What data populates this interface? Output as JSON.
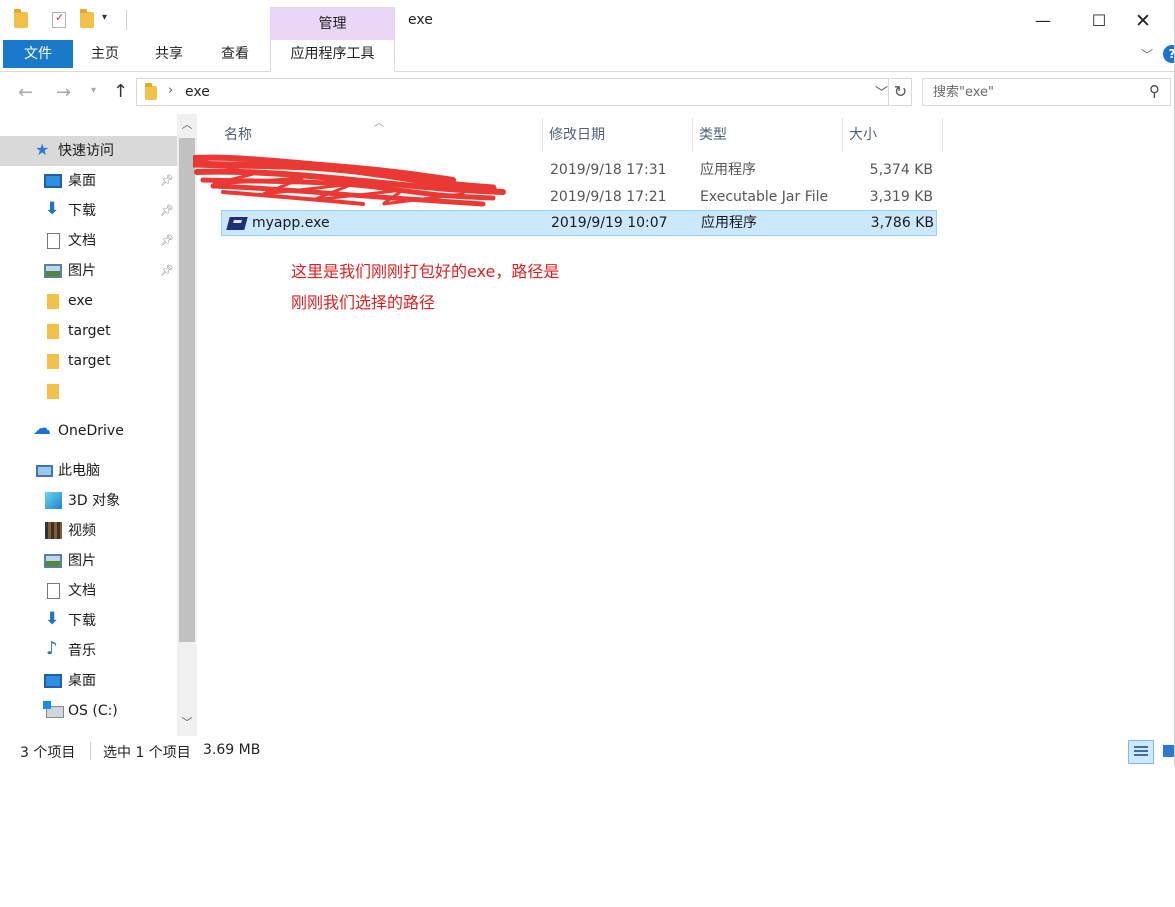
{
  "window": {
    "title": "exe",
    "contextual_tab_group": "管理",
    "controls": {
      "minimize": "—",
      "maximize": "☐",
      "close": "✕"
    }
  },
  "ribbon": {
    "tabs": [
      "文件",
      "主页",
      "共享",
      "查看",
      "应用程序工具"
    ],
    "help_label": "?"
  },
  "address_bar": {
    "path_segment": "exe",
    "search_placeholder": "搜索\"exe\""
  },
  "sidebar": {
    "quick_access": {
      "label": "快速访问"
    },
    "pinned": [
      {
        "label": "桌面",
        "icon": "desktop-icon"
      },
      {
        "label": "下载",
        "icon": "download-icon"
      },
      {
        "label": "文档",
        "icon": "document-icon"
      },
      {
        "label": "图片",
        "icon": "picture-icon"
      }
    ],
    "folders": [
      "exe",
      "target",
      "target",
      ""
    ],
    "onedrive": "OneDrive",
    "this_pc": "此电脑",
    "pc_items": [
      {
        "label": "3D 对象",
        "icon": "cube-3d-icon"
      },
      {
        "label": "视频",
        "icon": "video-icon"
      },
      {
        "label": "图片",
        "icon": "picture-icon"
      },
      {
        "label": "文档",
        "icon": "document-icon"
      },
      {
        "label": "下载",
        "icon": "download-icon"
      },
      {
        "label": "音乐",
        "icon": "music-icon"
      },
      {
        "label": "桌面",
        "icon": "desktop-icon"
      },
      {
        "label": "OS (C:)",
        "icon": "drive-icon"
      }
    ]
  },
  "file_list": {
    "columns": [
      "名称",
      "修改日期",
      "类型",
      "大小"
    ],
    "rows": [
      {
        "name": "",
        "date": "2019/9/18 17:31",
        "type": "应用程序",
        "size": "5,374 KB",
        "selected": false
      },
      {
        "name": "",
        "date": "2019/9/18 17:21",
        "type": "Executable Jar File",
        "size": "3,319 KB",
        "selected": false
      },
      {
        "name": "myapp.exe",
        "date": "2019/9/19 10:07",
        "type": "应用程序",
        "size": "3,786 KB",
        "selected": true
      }
    ]
  },
  "annotation": {
    "line1": "这里是我们刚刚打包好的exe，路径是",
    "line2": "刚刚我们选择的路径",
    "color": "#e02020"
  },
  "status_bar": {
    "item_count": "3 个项目",
    "selected": "选中 1 个项目",
    "selected_size": "3.69 MB"
  },
  "colors": {
    "file_tab": "#1979ca",
    "manage_tab": "#ead6f7",
    "selection": "#cce8ff",
    "redaction": "#e8231f"
  }
}
